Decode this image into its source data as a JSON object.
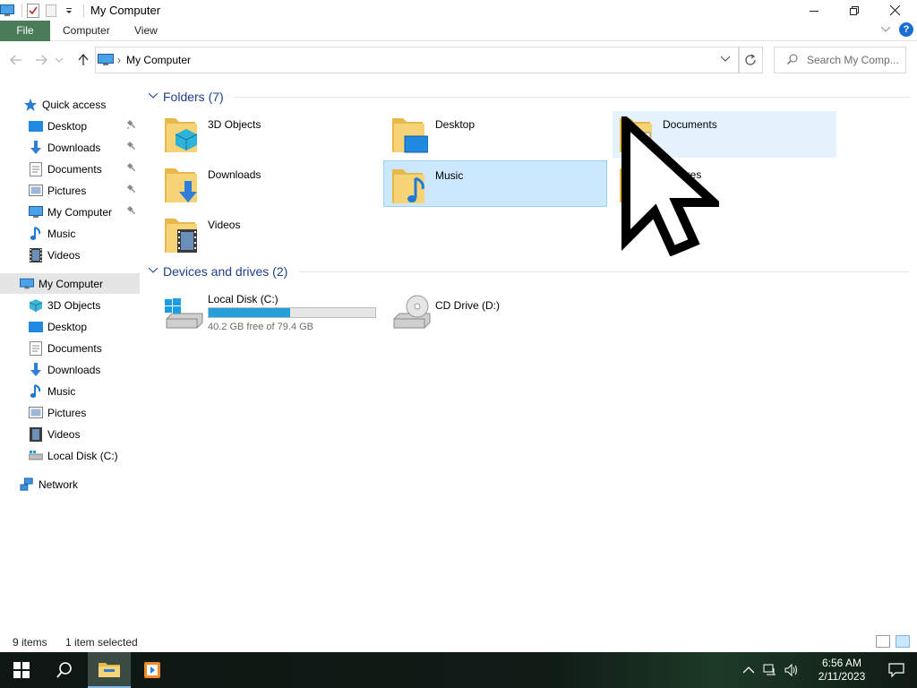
{
  "window": {
    "title": "My Computer"
  },
  "ribbon": {
    "tabs": [
      "File",
      "Computer",
      "View"
    ]
  },
  "address": {
    "path": "My Computer",
    "search_placeholder": "Search My Comp..."
  },
  "nav_pane": {
    "quick_access": {
      "label": "Quick access",
      "items": [
        {
          "label": "Desktop",
          "icon": "desktop-icon",
          "pinned": true
        },
        {
          "label": "Downloads",
          "icon": "downloads-icon",
          "pinned": true
        },
        {
          "label": "Documents",
          "icon": "documents-icon",
          "pinned": true
        },
        {
          "label": "Pictures",
          "icon": "pictures-icon",
          "pinned": true
        },
        {
          "label": "My Computer",
          "icon": "computer-icon",
          "pinned": true
        },
        {
          "label": "Music",
          "icon": "music-icon",
          "pinned": false
        },
        {
          "label": "Videos",
          "icon": "videos-icon",
          "pinned": false
        }
      ]
    },
    "this_pc": {
      "label": "My Computer",
      "items": [
        {
          "label": "3D Objects",
          "icon": "3d-objects-icon"
        },
        {
          "label": "Desktop",
          "icon": "desktop-icon"
        },
        {
          "label": "Documents",
          "icon": "documents-icon"
        },
        {
          "label": "Downloads",
          "icon": "downloads-icon"
        },
        {
          "label": "Music",
          "icon": "music-icon"
        },
        {
          "label": "Pictures",
          "icon": "pictures-icon"
        },
        {
          "label": "Videos",
          "icon": "videos-icon"
        },
        {
          "label": "Local Disk (C:)",
          "icon": "drive-icon"
        }
      ]
    },
    "network": {
      "label": "Network"
    }
  },
  "folders": {
    "header": "Folders (7)",
    "items": [
      {
        "label": "3D Objects",
        "icon": "3d-objects-folder-icon",
        "state": "normal"
      },
      {
        "label": "Desktop",
        "icon": "desktop-folder-icon",
        "state": "normal"
      },
      {
        "label": "Documents",
        "icon": "documents-folder-icon",
        "state": "hover"
      },
      {
        "label": "Downloads",
        "icon": "downloads-folder-icon",
        "state": "normal"
      },
      {
        "label": "Music",
        "icon": "music-folder-icon",
        "state": "selected"
      },
      {
        "label": "Pictures",
        "icon": "pictures-folder-icon",
        "state": "normal"
      },
      {
        "label": "Videos",
        "icon": "videos-folder-icon",
        "state": "normal"
      }
    ]
  },
  "drives": {
    "header": "Devices and drives (2)",
    "items": [
      {
        "label": "Local Disk (C:)",
        "free_text": "40.2 GB free of 79.4 GB",
        "used_fraction": 0.49
      },
      {
        "label": "CD Drive (D:)"
      }
    ]
  },
  "status": {
    "item_count": "9 items",
    "selection": "1 item selected"
  },
  "taskbar": {
    "time": "6:56 AM",
    "date": "2/11/2023"
  },
  "colors": {
    "selection_bg": "#cce8ff",
    "hover_bg": "#e5f3ff",
    "header_blue": "#1f3f8a",
    "progress": "#26a0da",
    "file_tab": "#4a7c59"
  }
}
